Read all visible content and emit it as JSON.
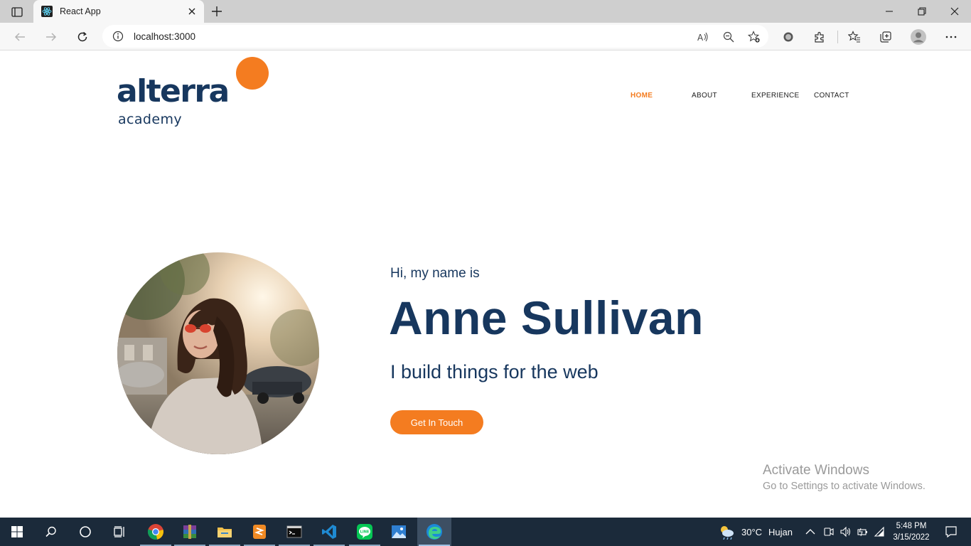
{
  "browser": {
    "tab_title": "React App",
    "url": "localhost:3000"
  },
  "site": {
    "logo": {
      "word": "alterra",
      "sub": "academy"
    },
    "nav": [
      "HOME",
      "ABOUT",
      "EXPERIENCE",
      "CONTACT"
    ],
    "active_nav": "HOME",
    "hero": {
      "greeting": "Hi, my name is",
      "name": "Anne Sullivan",
      "tagline": "I build things for the web",
      "cta": "Get In Touch"
    },
    "colors": {
      "accent": "#f47c20",
      "navy": "#17375e"
    }
  },
  "watermark": {
    "title": "Activate Windows",
    "subtitle": "Go to Settings to activate Windows."
  },
  "taskbar": {
    "apps": [
      "chrome-icon",
      "winrar-icon",
      "file-explorer-icon",
      "sublime-text-icon",
      "terminal-icon",
      "vscode-icon",
      "line-icon",
      "photos-icon",
      "edge-icon"
    ],
    "weather": {
      "temp": "30°C",
      "condition": "Hujan"
    },
    "time": "5:48 PM",
    "date": "3/15/2022"
  }
}
